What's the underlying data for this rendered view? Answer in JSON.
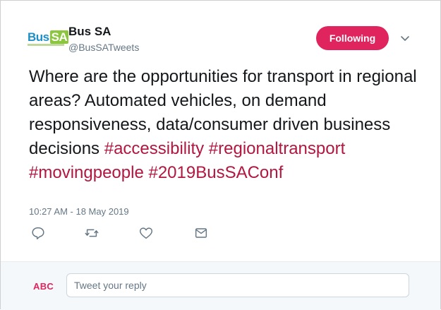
{
  "account": {
    "name": "Bus SA",
    "handle": "@BusSATweets",
    "logo_text_main": "Bus",
    "logo_text_accent": "SA"
  },
  "follow_button": {
    "label": "Following"
  },
  "tweet": {
    "text_plain": "Where are the opportunities for transport in regional areas? Automated vehicles, on demand responsiveness, data/consumer driven business decisions ",
    "hashtags": [
      "#accessibility",
      "#regionaltransport",
      "#movingpeople",
      "#2019BusSAConf"
    ],
    "timestamp": "10:27 AM - 18 May 2019"
  },
  "actions": {
    "icons": [
      "reply-icon",
      "retweet-icon",
      "like-icon",
      "direct-message-icon"
    ]
  },
  "reply": {
    "avatar_text": "ABC",
    "placeholder": "Tweet your reply"
  },
  "colors": {
    "accent": "#e0245e",
    "hashtag": "#b3163f",
    "muted": "#657786",
    "text": "#14171a"
  }
}
